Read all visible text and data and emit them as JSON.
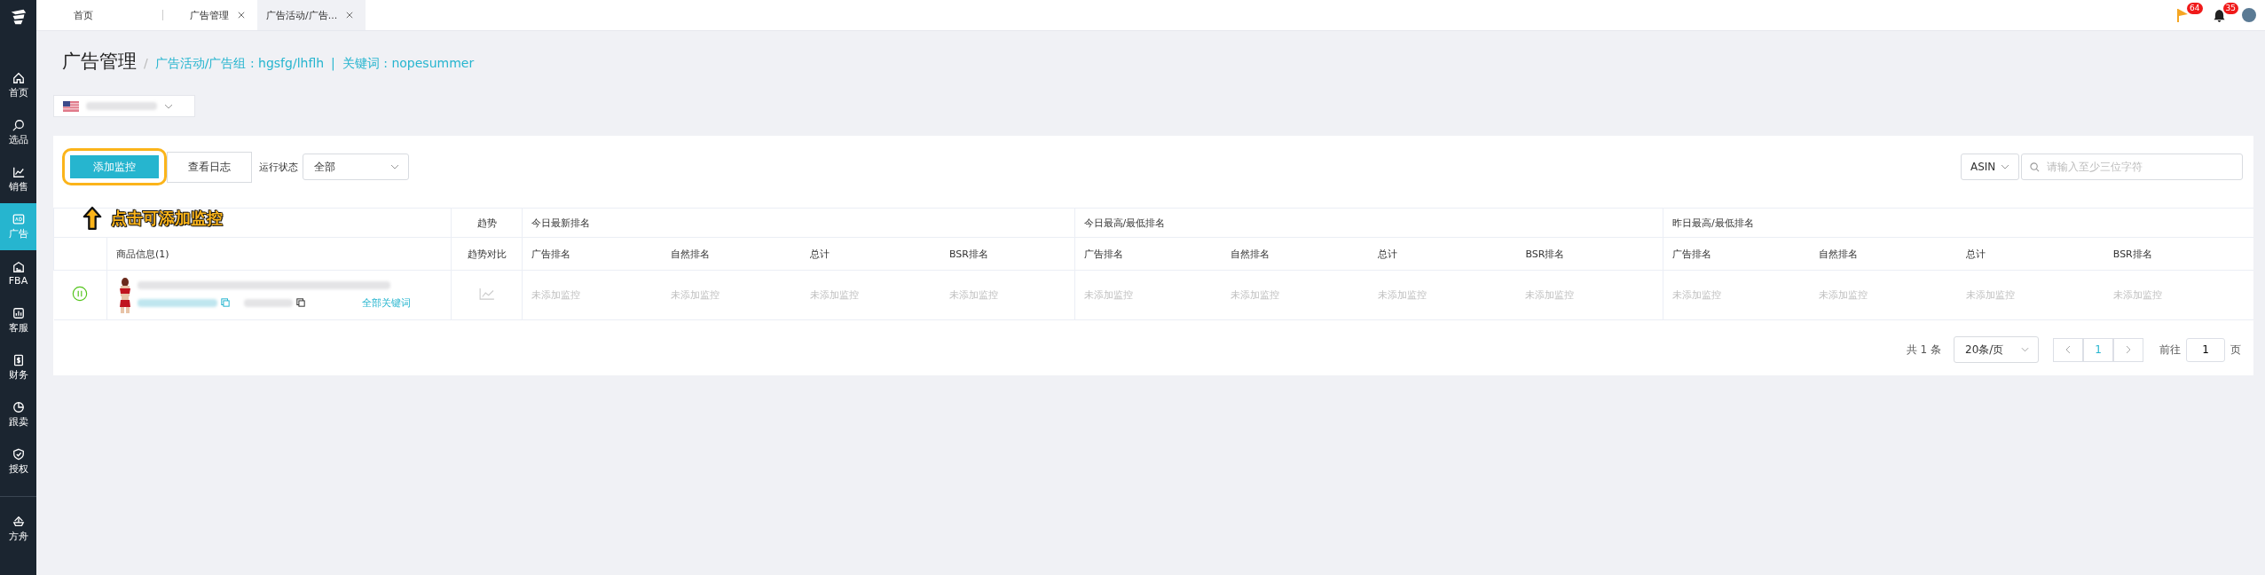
{
  "sidebar": {
    "items": [
      {
        "label": "首页",
        "selected": false
      },
      {
        "label": "选品",
        "selected": false
      },
      {
        "label": "销售",
        "selected": false
      },
      {
        "label": "广告",
        "selected": true
      },
      {
        "label": "FBA",
        "selected": false
      },
      {
        "label": "客服",
        "selected": false
      },
      {
        "label": "财务",
        "selected": false
      },
      {
        "label": "跟卖",
        "selected": false
      },
      {
        "label": "授权",
        "selected": false
      }
    ],
    "bottom_item": {
      "label": "方舟",
      "selected": false
    }
  },
  "tabs": [
    {
      "label": "首页",
      "closable": false,
      "selected": false
    },
    {
      "label": "广告管理",
      "closable": true,
      "selected": false
    },
    {
      "label": "广告活动/广告...",
      "closable": true,
      "selected": true
    }
  ],
  "notifications": [
    {
      "kind": "flag",
      "count": "64"
    },
    {
      "kind": "bell",
      "count": "35"
    }
  ],
  "header": {
    "title": "广告管理",
    "separator": "/",
    "campaign": "广告活动/广告组 : hgsfg/lhflh",
    "divider": "|",
    "keyword": "关键词 : nopesummer"
  },
  "toolbar": {
    "add_button": "添加监控",
    "log_button": "查看日志",
    "status_label": "运行状态",
    "status_value": "全部",
    "search_type": "ASIN",
    "search_placeholder": "请输入至少三位字符"
  },
  "annotation": {
    "text": "点击可添加监控"
  },
  "table": {
    "group_headers": [
      "趋势",
      "今日最新排名",
      "今日最高/最低排名",
      "昨日最高/最低排名"
    ],
    "columns": [
      "",
      "商品信息(1)",
      "趋势对比",
      "广告排名",
      "自然排名",
      "总计",
      "BSR排名",
      "广告排名",
      "自然排名",
      "总计",
      "BSR排名",
      "广告排名",
      "自然排名",
      "总计",
      "BSR排名"
    ],
    "rows": [
      {
        "running": true,
        "link": "全部关键词",
        "cells": [
          "",
          "",
          "",
          "未添加监控",
          "未添加监控",
          "未添加监控",
          "未添加监控",
          "未添加监控",
          "未添加监控",
          "未添加监控",
          "未添加监控",
          "未添加监控",
          "未添加监控",
          "未添加监控",
          "未添加监控"
        ]
      }
    ]
  },
  "pagination": {
    "total": "共 1 条",
    "page_size": "20条/页",
    "current_page": "1",
    "goto_label": "前往",
    "goto_value": "1",
    "page_suffix": "页"
  }
}
